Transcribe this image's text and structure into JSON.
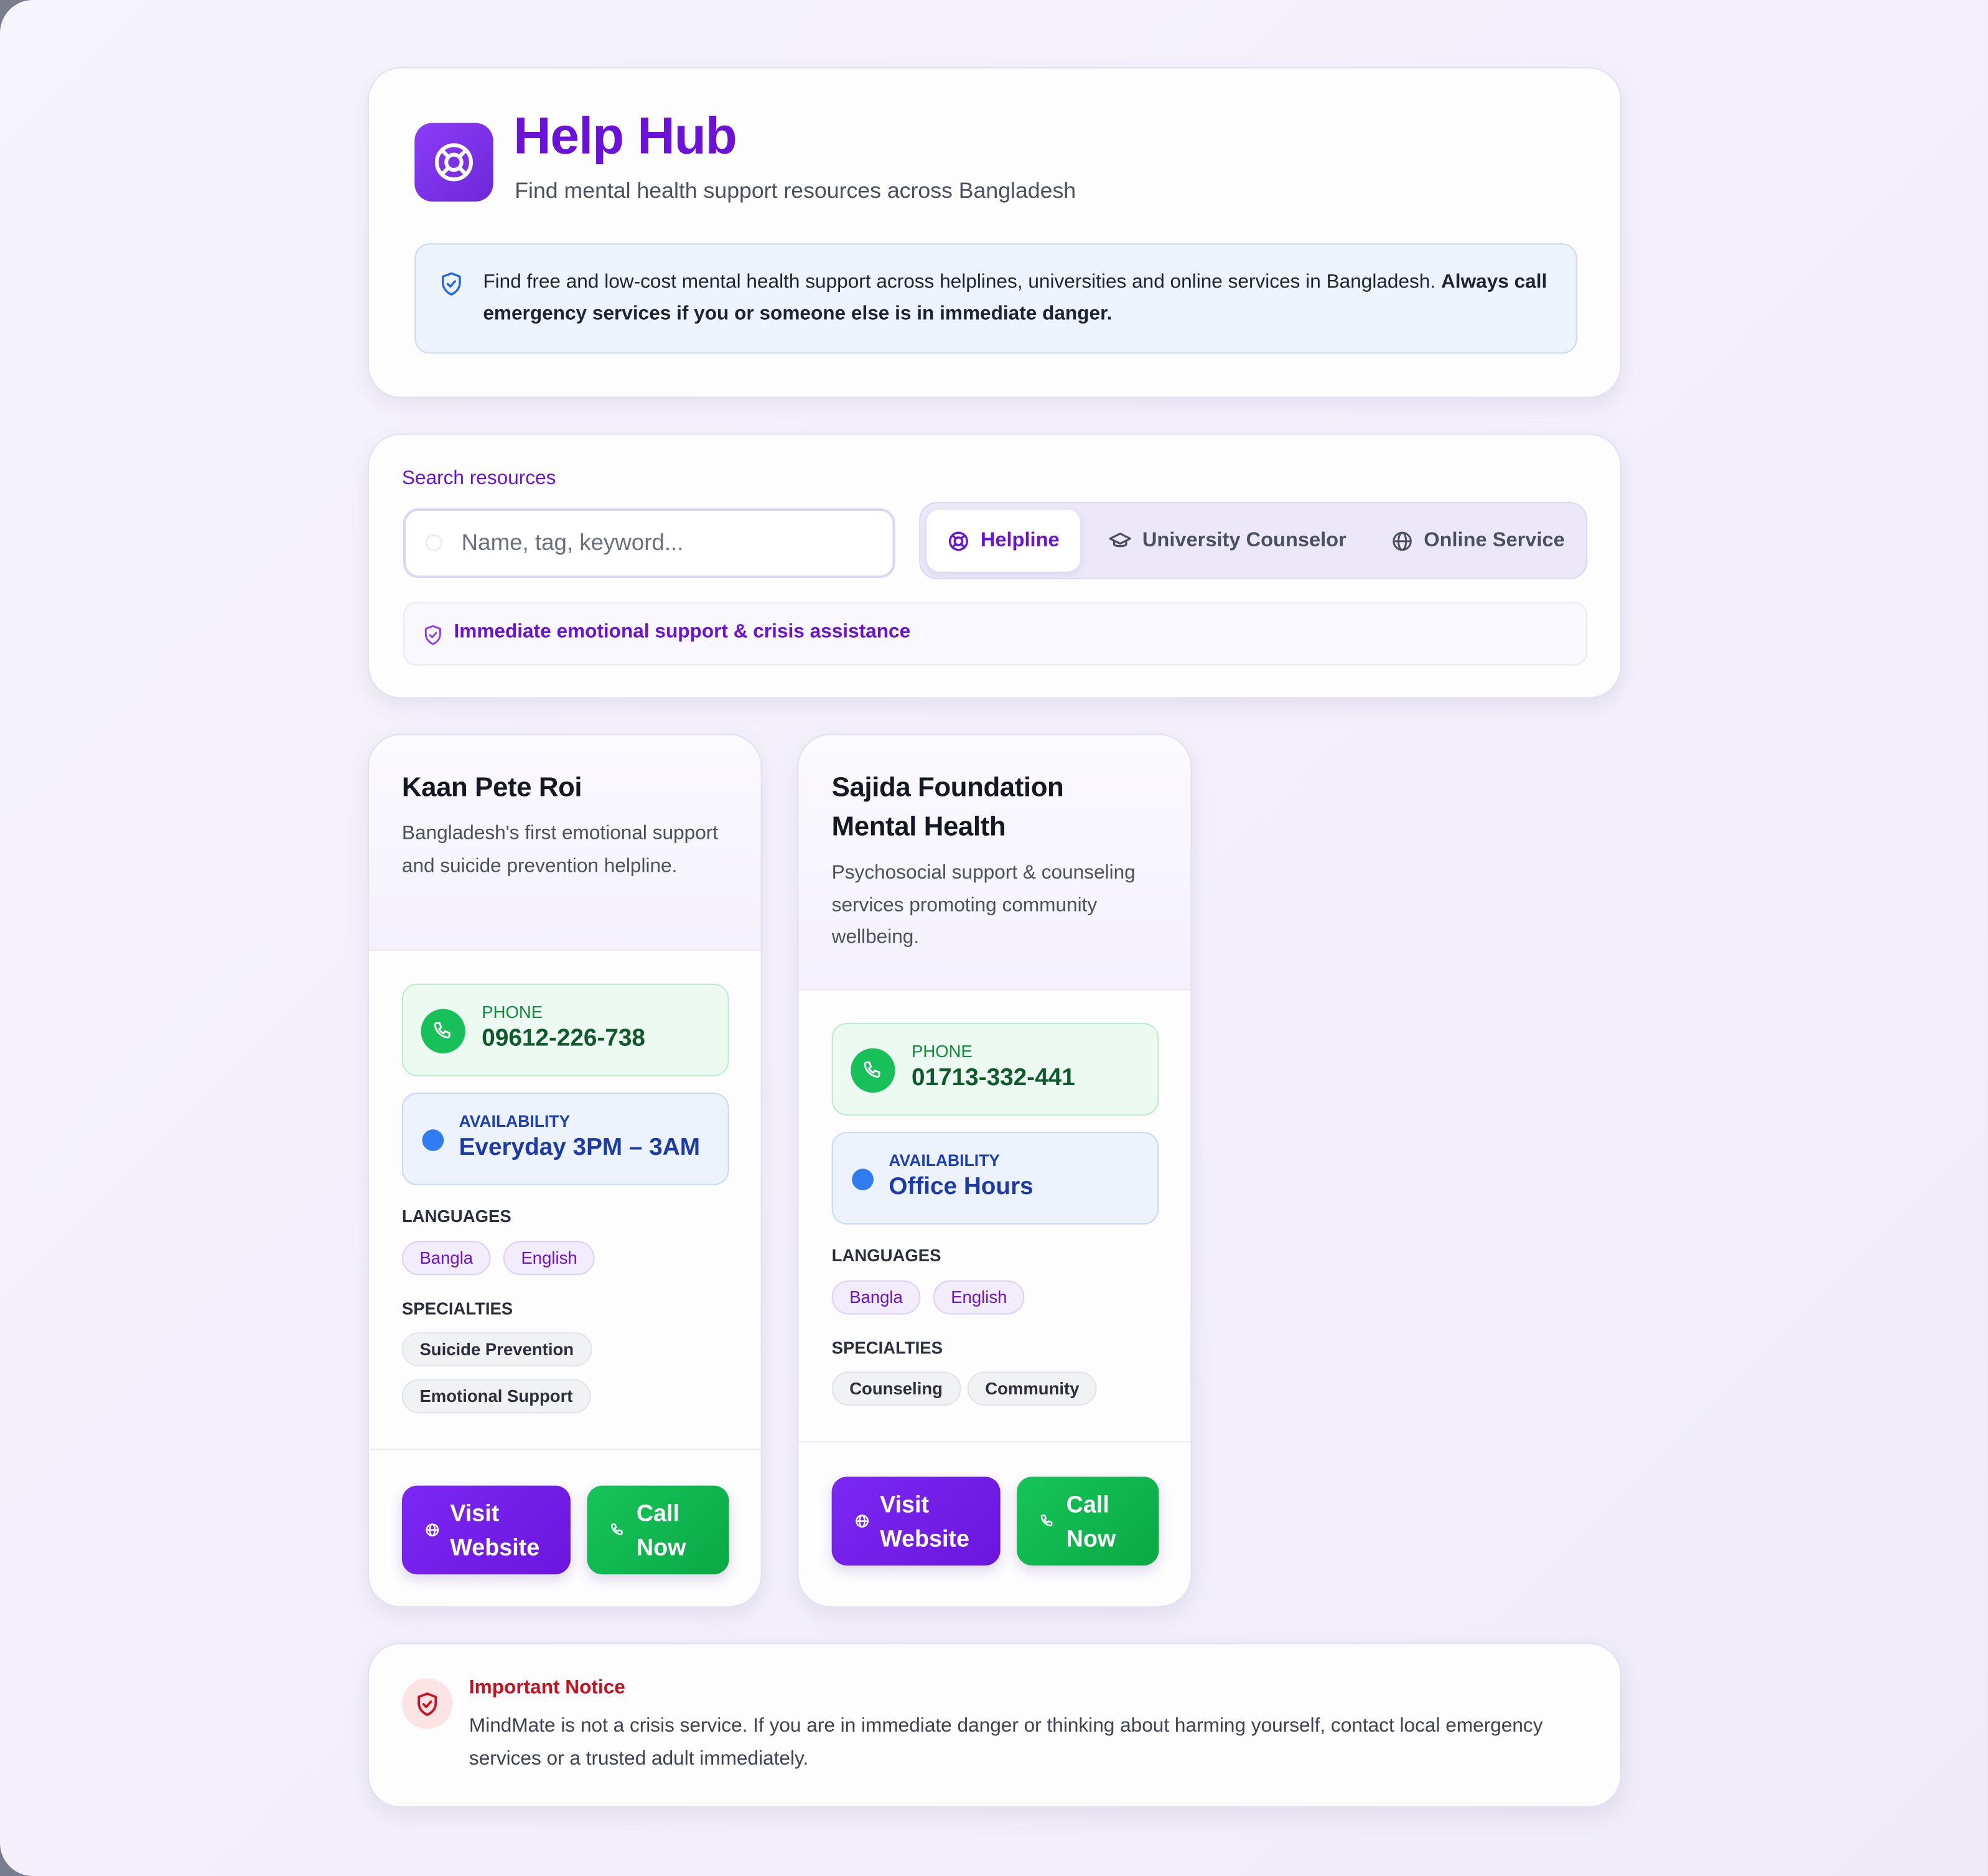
{
  "header": {
    "title": "Help Hub",
    "subtitle": "Find mental health support resources across Bangladesh",
    "logo_icon": "lifebuoy-icon",
    "info_text": "Find free and low-cost mental health support across helplines, universities and online services in Bangladesh. ",
    "info_bold": "Always call emergency services if you or someone else is in immediate danger.",
    "info_icon": "shield-check-icon"
  },
  "search": {
    "label": "Search resources",
    "placeholder": "Name, tag, keyword...",
    "tabs": [
      {
        "label": "Helpline",
        "icon": "lifebuoy-icon",
        "active": true
      },
      {
        "label": "University Counselor",
        "icon": "graduation-cap-icon",
        "active": false
      },
      {
        "label": "Online Service",
        "icon": "globe-icon",
        "active": false
      }
    ],
    "category_text": "Immediate emotional support & crisis assistance"
  },
  "resources": [
    {
      "name": "Kaan Pete Roi",
      "description": "Bangladesh's first emotional support and suicide prevention helpline.",
      "phone_label": "PHONE",
      "phone": "09612-226-738",
      "availability_label": "AVAILABILITY",
      "availability": "Everyday 3PM – 3AM",
      "languages_label": "LANGUAGES",
      "languages": [
        "Bangla",
        "English"
      ],
      "specialties_label": "SPECIALTIES",
      "specialties": [
        "Suicide Prevention",
        "Emotional Support"
      ],
      "website_line1": "Visit",
      "website_line2": "Website",
      "call_line1": "Call",
      "call_line2": "Now"
    },
    {
      "name_line1": "Sajida Foundation",
      "name_line2": "Mental Health",
      "description": "Psychosocial support & counseling services promoting community wellbeing.",
      "phone_label": "PHONE",
      "phone": "01713-332-441",
      "availability_label": "AVAILABILITY",
      "availability": "Office Hours",
      "languages_label": "LANGUAGES",
      "languages": [
        "Bangla",
        "English"
      ],
      "specialties_label": "SPECIALTIES",
      "specialties": [
        "Counseling",
        "Community"
      ],
      "website_line1": "Visit",
      "website_line2": "Website",
      "call_line1": "Call",
      "call_line2": "Now"
    }
  ],
  "notice": {
    "title": "Important Notice",
    "text": "MindMate is not a crisis service. If you are in immediate danger or thinking about harming yourself, contact local emergency services or a trusted adult immediately.",
    "icon": "shield-alert-icon"
  },
  "colors": {
    "brand_purple": "#6b12d9",
    "call_green": "#16c55a",
    "availability_blue": "#2f7df0",
    "notice_red": "#cc0f1c"
  }
}
